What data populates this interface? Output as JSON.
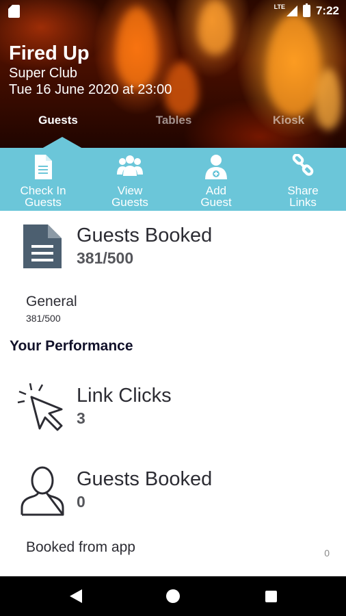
{
  "status_bar": {
    "network": "LTE",
    "time": "7:22",
    "icons": [
      "sd-card-icon",
      "signal-icon",
      "battery-icon"
    ]
  },
  "event": {
    "title": "Fired Up",
    "venue": "Super Club",
    "date": "Tue 16 June 2020 at 23:00"
  },
  "tabs": [
    {
      "label": "Guests",
      "active": true
    },
    {
      "label": "Tables",
      "active": false
    },
    {
      "label": "Kiosk",
      "active": false
    }
  ],
  "actions": [
    {
      "label": "Check In\nGuests",
      "icon": "document-icon"
    },
    {
      "label": "View\nGuests",
      "icon": "group-icon"
    },
    {
      "label": "Add\nGuest",
      "icon": "add-user-icon"
    },
    {
      "label": "Share\nLinks",
      "icon": "link-icon"
    }
  ],
  "summary": {
    "title": "Guests Booked",
    "value": "381/500",
    "breakdown_label": "General",
    "breakdown_value": "381/500"
  },
  "performance": {
    "heading": "Your Performance",
    "link_clicks_title": "Link Clicks",
    "link_clicks_value": "3",
    "guests_booked_title": "Guests Booked",
    "guests_booked_value": "0",
    "booked_from_app_label": "Booked from app",
    "booked_from_app_value": "0"
  },
  "colors": {
    "accent": "#6bc6d9",
    "icon_dark": "#4c5f70",
    "nav_bar": "#000000"
  }
}
